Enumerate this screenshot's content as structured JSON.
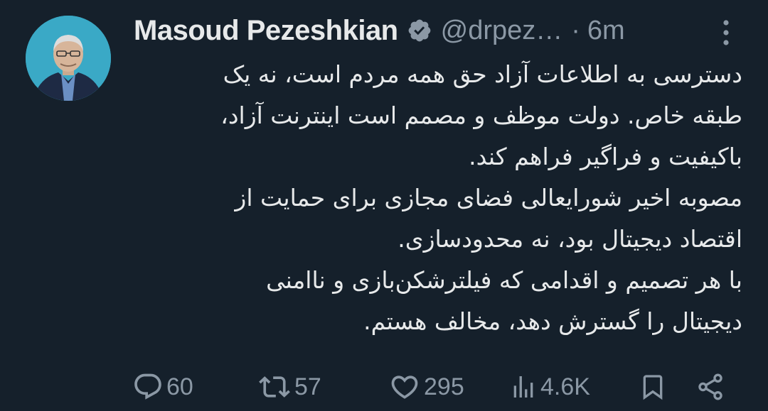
{
  "tweet": {
    "author": {
      "display_name": "Masoud Pezeshkian",
      "handle": "@drpez…",
      "verified_icon": "verified-badge-icon",
      "avatar": "portrait-avatar"
    },
    "separator": "·",
    "time_ago": "6m",
    "more_icon": "more-vertical-icon",
    "body_lines": [
      "دسترسی به اطلاعات آزاد حق همه مردم است، نه یک",
      "طبقه خاص. دولت موظف و مصمم است اینترنت آزاد،",
      "باکیفیت و فراگیر فراهم کند.",
      "مصوبه اخیر شورایعالی فضای مجازی برای حمایت از",
      "اقتصاد دیجیتال بود، نه محدودسازی.",
      "با هر تصمیم و اقدامی که فیلترشکن‌بازی و ناامنی",
      "دیجیتال را گسترش دهد، مخالف هستم."
    ],
    "actions": {
      "replies": "60",
      "retweets": "57",
      "likes": "295",
      "views": "4.6K"
    }
  },
  "colors": {
    "background": "#15202b",
    "text": "#e7e9ea",
    "secondary": "#8b98a5",
    "avatar_bg": "#3aa9c6"
  }
}
